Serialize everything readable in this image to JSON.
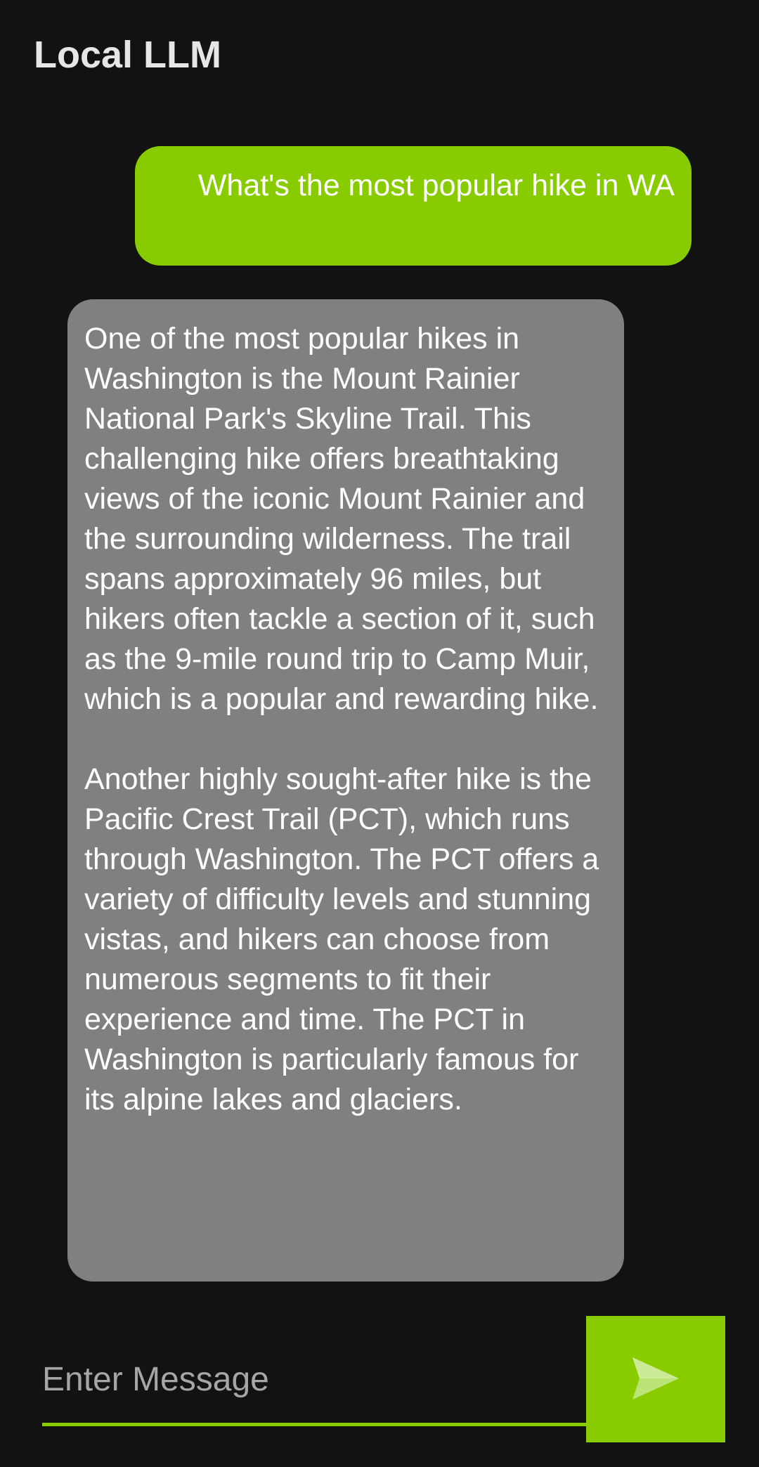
{
  "app": {
    "title": "Local LLM"
  },
  "conversation": {
    "messages": [
      {
        "role": "user",
        "text": "What's the most popular hike in WA"
      },
      {
        "role": "assistant",
        "text": "One of the most popular hikes in Washington is the Mount Rainier National Park's Skyline Trail. This challenging hike offers breathtaking views of the iconic Mount Rainier and the surrounding wilderness. The trail spans approximately 96 miles, but hikers often tackle a section of it, such as the 9-mile round trip to Camp Muir, which is a popular and rewarding hike.\n\nAnother highly sought-after hike is the Pacific Crest Trail (PCT), which runs through Washington. The PCT offers a variety of difficulty levels and stunning vistas, and hikers can choose from numerous segments to fit their experience and time. The PCT in Washington is particularly famous for its alpine lakes and glaciers."
      }
    ]
  },
  "composer": {
    "placeholder": "Enter Message",
    "value": "",
    "send_icon": "send-icon"
  },
  "colors": {
    "background": "#121212",
    "accent": "#88cc00",
    "assistant_bubble": "#808080",
    "title_text": "#e6e6e6",
    "placeholder_text": "#a6a6a6"
  }
}
